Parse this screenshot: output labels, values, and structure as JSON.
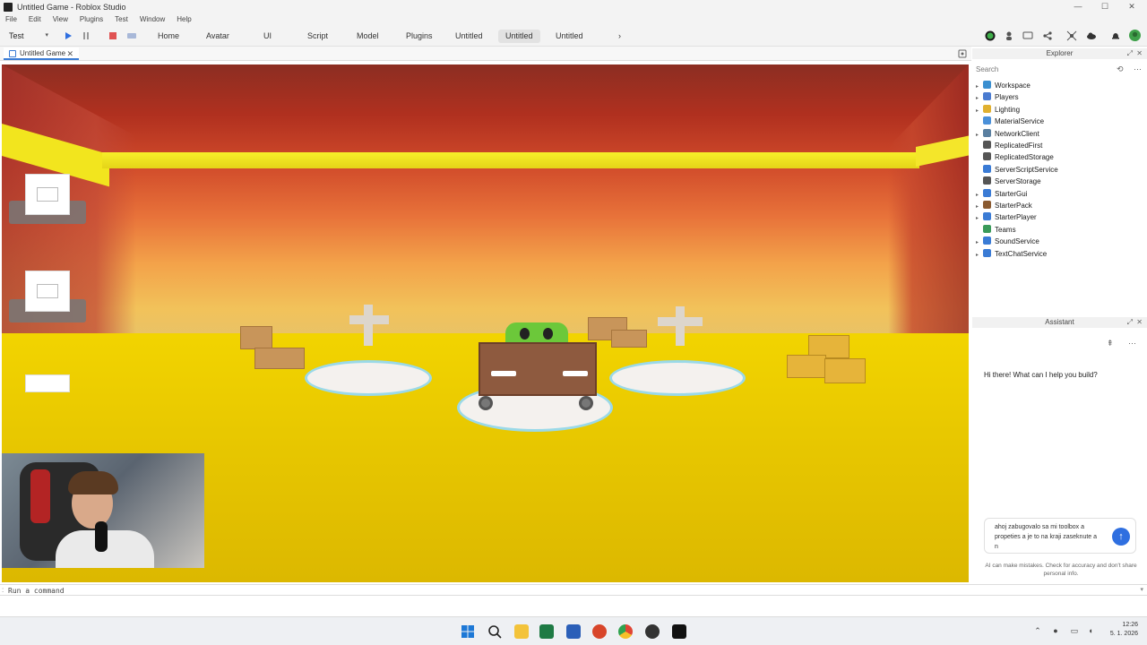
{
  "window": {
    "title": "Untitled Game - Roblox Studio",
    "min": "—",
    "max": "☐",
    "close": "✕"
  },
  "menu": [
    "File",
    "Edit",
    "View",
    "Plugins",
    "Test",
    "Window",
    "Help"
  ],
  "ribbon": {
    "mode": "Test",
    "tabs": [
      "Home",
      "Avatar",
      "UI",
      "Script",
      "Model",
      "Plugins",
      "Untitled",
      "Untitled",
      "Untitled"
    ],
    "active_tab_index": 7,
    "more": "›"
  },
  "doc_tab": {
    "label": "Untitled Game",
    "close": "✕"
  },
  "explorer": {
    "title": "Explorer",
    "search_placeholder": "Search",
    "items": [
      {
        "label": "Workspace",
        "expandable": true,
        "color": "#3a8fd0"
      },
      {
        "label": "Players",
        "expandable": true,
        "color": "#4a7bd0"
      },
      {
        "label": "Lighting",
        "expandable": true,
        "color": "#e0b030"
      },
      {
        "label": "MaterialService",
        "expandable": false,
        "color": "#4a90d9"
      },
      {
        "label": "NetworkClient",
        "expandable": true,
        "color": "#5a7fa0"
      },
      {
        "label": "ReplicatedFirst",
        "expandable": false,
        "color": "#555555"
      },
      {
        "label": "ReplicatedStorage",
        "expandable": false,
        "color": "#555555"
      },
      {
        "label": "ServerScriptService",
        "expandable": false,
        "color": "#3a7bd5"
      },
      {
        "label": "ServerStorage",
        "expandable": false,
        "color": "#555555"
      },
      {
        "label": "StarterGui",
        "expandable": true,
        "color": "#3a7bd5"
      },
      {
        "label": "StarterPack",
        "expandable": true,
        "color": "#8a5a30"
      },
      {
        "label": "StarterPlayer",
        "expandable": true,
        "color": "#3a7bd5"
      },
      {
        "label": "Teams",
        "expandable": false,
        "color": "#3a9a5a"
      },
      {
        "label": "SoundService",
        "expandable": true,
        "color": "#3a7bd5"
      },
      {
        "label": "TextChatService",
        "expandable": true,
        "color": "#3a7bd5"
      }
    ]
  },
  "assistant": {
    "title": "Assistant",
    "greeting": "Hi there! What can I help you build?",
    "input_value": "ahoj zabugovalo sa mi toolbox a propeties a je to na kraji zaseknute a n",
    "send": "↑",
    "disclaimer": "AI can make mistakes. Check for accuracy and don't share personal info."
  },
  "command_bar": {
    "placeholder": "Run a command"
  },
  "taskbar": {
    "time": "12:26",
    "date": "5. 1. 2026"
  }
}
